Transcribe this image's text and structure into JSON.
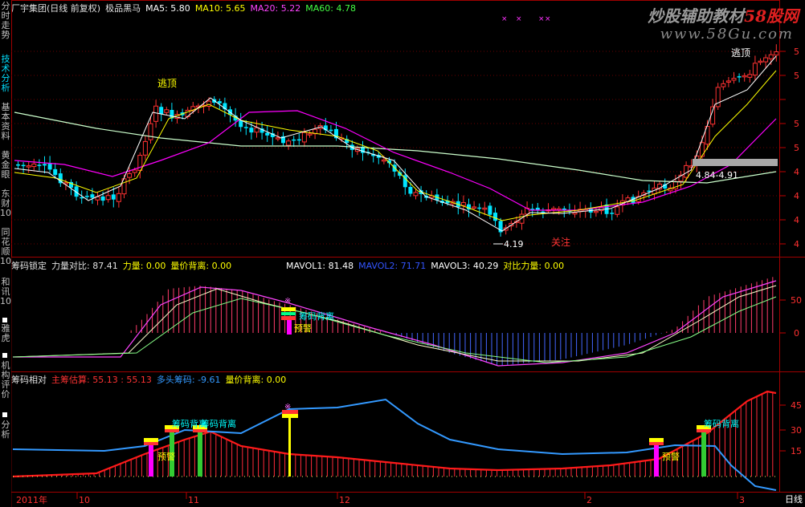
{
  "sidebar": {
    "items": [
      {
        "label": "分时走势"
      },
      {
        "label": "技术分析"
      },
      {
        "label": "基本资料"
      },
      {
        "label": "黄金眼"
      },
      {
        "label": "东财10"
      },
      {
        "label": "同花顺10"
      },
      {
        "label": "和讯10"
      },
      {
        "label": "雅虎"
      },
      {
        "label": "机构评价"
      },
      {
        "label": "分析"
      }
    ]
  },
  "main_header": {
    "title": "厂宇集团(日线 前复权)",
    "indicator": "极品黑马",
    "ma5": "MA5: 5.80",
    "ma10": "MA10: 5.65",
    "ma20": "MA20: 5.22",
    "ma60": "MA60: 4.78"
  },
  "main_annotations": {
    "top_left": "逃顶",
    "top_right": "逃顶",
    "low_price": "4.19",
    "attention": "关注",
    "range": "4.84-4.91"
  },
  "price_axis": [
    "5",
    "5",
    "5",
    "5",
    "4",
    "4",
    "4",
    "4"
  ],
  "sub1_header": {
    "name": "筹码锁定",
    "power_ratio": "力量对比: 87.41",
    "power": "力量: 0.00",
    "divergence": "量价背离: 0.00",
    "mavol1": "MAVOL1: 81.48",
    "mavol2": "MAVOL2: 71.71",
    "mavol3": "MAVOL3: 40.29",
    "compare": "对比力量: 0.00"
  },
  "sub1_annotations": {
    "divergence": "筹码背离",
    "warning": "预警"
  },
  "sub1_axis": [
    "50",
    "0"
  ],
  "sub2_header": {
    "name": "筹码相对",
    "main_estimate": "主筹估算: 55.13 : 55.13",
    "long_chip": "多头筹码: -9.61",
    "divergence": "量价背离: 0.00"
  },
  "sub2_annotations": {
    "warning1": "预警",
    "divergence1": "筹码背离",
    "divergence2": "筹码背离",
    "warning2": "预警",
    "divergence3": "筹码背离"
  },
  "sub2_axis": [
    "45",
    "30",
    "15"
  ],
  "time_axis": [
    "2011年",
    "10",
    "11",
    "12",
    "2",
    "3"
  ],
  "period_button": "日线",
  "watermark": {
    "line1_a": "炒股辅助教材",
    "line1_b": "58股网",
    "line2": "www.58Gu.com"
  },
  "colors": {
    "up": "#ff3232",
    "down": "#00e5ff",
    "ma5": "#ffffff",
    "ma10": "#ffff00",
    "ma20": "#ff00ff",
    "ma60": "#00ff00",
    "border": "#a00000",
    "blue_line": "#3399ff"
  }
}
